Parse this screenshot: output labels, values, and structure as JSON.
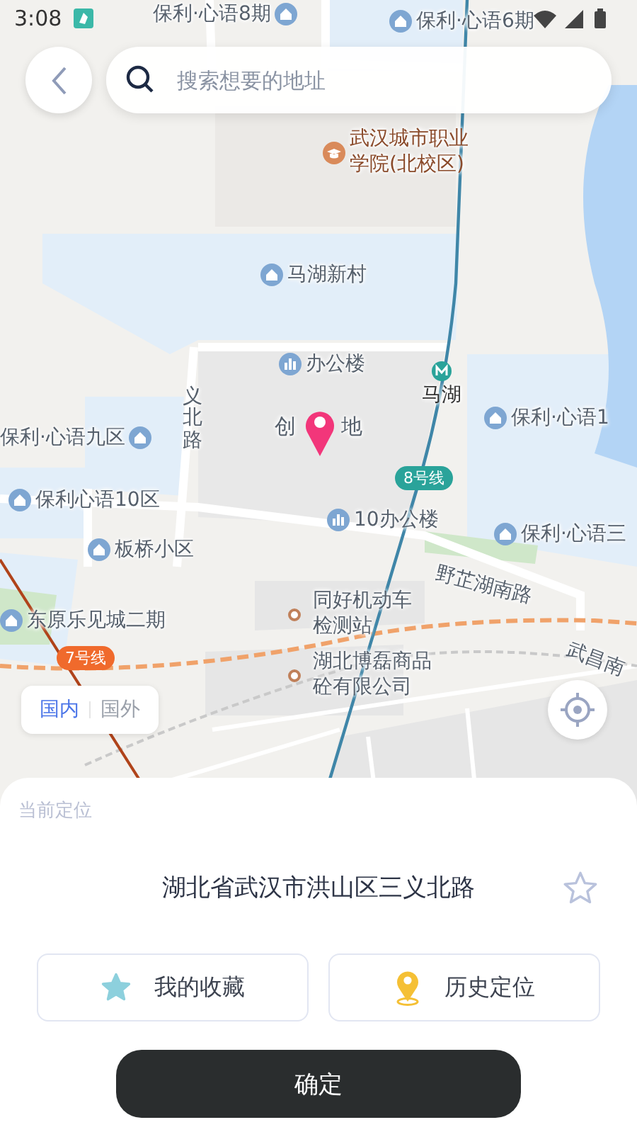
{
  "status_bar": {
    "time": "3:08"
  },
  "search": {
    "placeholder": "搜索想要的地址"
  },
  "map": {
    "labels": [
      {
        "kind": "home",
        "text": "保利·心语8期"
      },
      {
        "kind": "home",
        "text": "保利·心语6期"
      },
      {
        "kind": "school",
        "text": "武汉城市职业学院(北校区)"
      },
      {
        "kind": "home",
        "text": "马湖新村"
      },
      {
        "kind": "office",
        "text": "办公楼"
      },
      {
        "kind": "road",
        "text": "义北路"
      },
      {
        "kind": "metro",
        "text": "马湖"
      },
      {
        "kind": "home",
        "text": "保利·心语1"
      },
      {
        "kind": "home",
        "text": "保利·心语九区"
      },
      {
        "kind": "place",
        "text": "创"
      },
      {
        "kind": "place",
        "text": "地"
      },
      {
        "kind": "badge",
        "text": "8号线",
        "color": "#2aa39a"
      },
      {
        "kind": "home",
        "text": "保利心语10区"
      },
      {
        "kind": "office",
        "text": "10办公楼"
      },
      {
        "kind": "home",
        "text": "保利·心语三"
      },
      {
        "kind": "home",
        "text": "板桥小区"
      },
      {
        "kind": "road",
        "text": "野芷湖南路"
      },
      {
        "kind": "home",
        "text": "东原乐见城二期"
      },
      {
        "kind": "poi",
        "text": "同好机动车检测站"
      },
      {
        "kind": "road",
        "text": "武昌南"
      },
      {
        "kind": "badge",
        "text": "7号线",
        "color": "#f06a2c"
      },
      {
        "kind": "poi",
        "text": "湖北博磊商品砼有限公司"
      }
    ]
  },
  "region_toggle": [
    {
      "label": "国内",
      "selected": true
    },
    {
      "label": "国外",
      "selected": false
    }
  ],
  "sheet": {
    "title": "当前定位",
    "address": "湖北省武汉市洪山区三义北路",
    "favorite": false,
    "buttons": [
      {
        "kind": "favorites",
        "label": "我的收藏"
      },
      {
        "kind": "history",
        "label": "历史定位"
      }
    ],
    "confirm": "确定"
  }
}
